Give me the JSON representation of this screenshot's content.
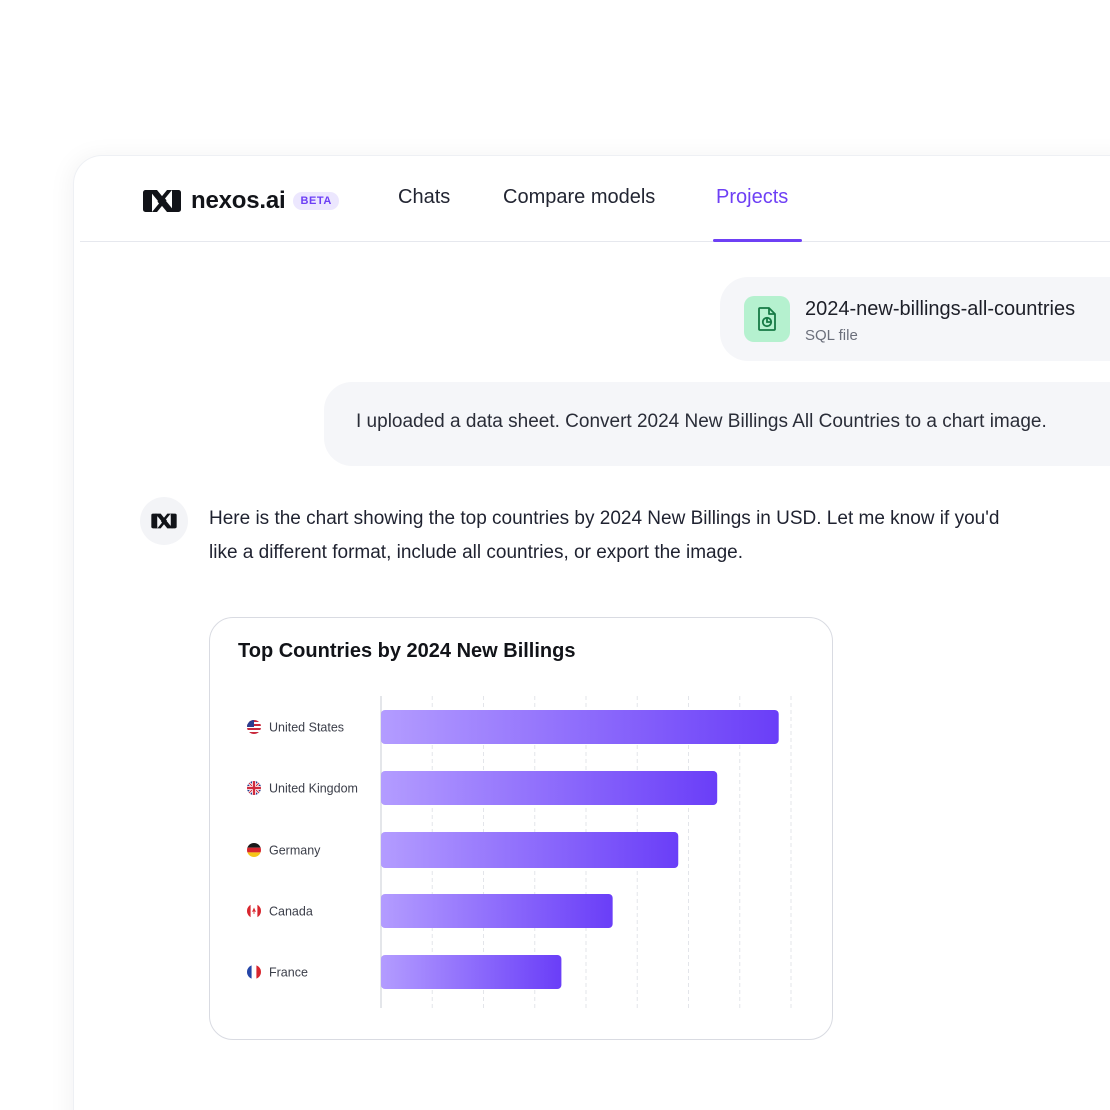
{
  "brand": {
    "name": "nexos.ai",
    "badge": "BETA"
  },
  "nav": {
    "tabs": [
      {
        "label": "Chats"
      },
      {
        "label": "Compare models"
      },
      {
        "label": "Projects"
      }
    ],
    "active": "Projects"
  },
  "attachment": {
    "name": "2024-new-billings-all-countries",
    "type": "SQL file",
    "icon": "file-chart-icon",
    "icon_bg": "#b5f1cf"
  },
  "user_message": {
    "text": "I uploaded a data sheet. Convert 2024 New Billings All Countries to a chart image."
  },
  "assistant_message": {
    "line1": "Here is the chart showing the top countries by 2024 New Billings in USD. Let me know if you'd",
    "line2": "like a different format, include all countries, or export the image."
  },
  "colors": {
    "accent": "#6e40f5",
    "bar_start": "#b39cff",
    "bar_end": "#6a3ef8"
  },
  "chart_data": {
    "type": "bar",
    "orientation": "horizontal",
    "title": "Top Countries by 2024 New Billings",
    "categories": [
      "United States",
      "United Kingdom",
      "Germany",
      "Canada",
      "France"
    ],
    "flags": [
      "us-flag-icon",
      "uk-flag-icon",
      "germany-flag-icon",
      "canada-flag-icon",
      "france-flag-icon"
    ],
    "values": [
      97,
      82,
      72.5,
      56.5,
      44
    ],
    "xlim": [
      0,
      100
    ],
    "grid": true,
    "xlabel": "",
    "ylabel": ""
  }
}
